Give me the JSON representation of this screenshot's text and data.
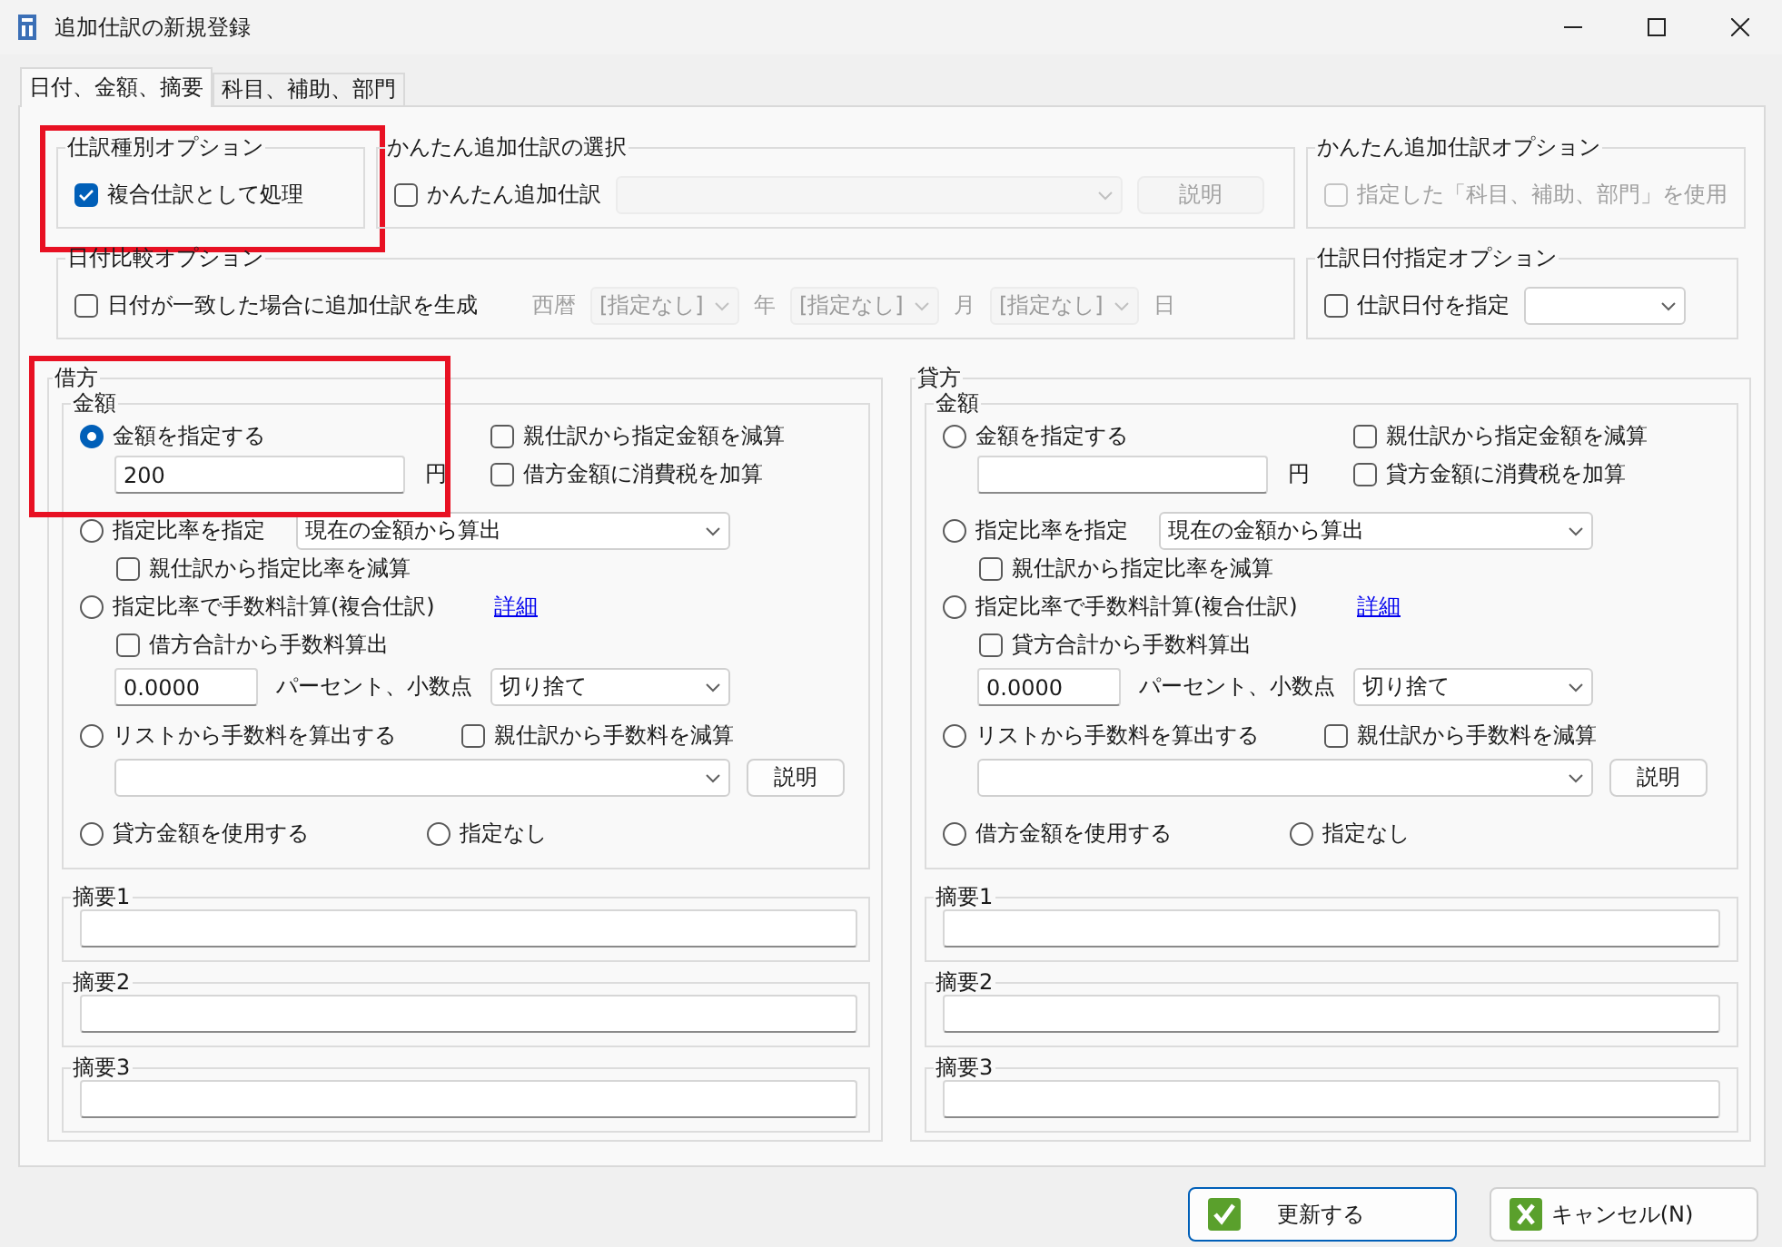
{
  "window": {
    "title": "追加仕訳の新規登録"
  },
  "tabs": [
    {
      "label": "日付、金額、摘要",
      "selected": true
    },
    {
      "label": "科目、補助、部門",
      "selected": false
    }
  ],
  "entry_type_option": {
    "title": "仕訳種別オプション",
    "highlighted": true,
    "checkbox": {
      "label": "複合仕訳として処理",
      "checked": true
    }
  },
  "easy_entry_select": {
    "title": "かんたん追加仕訳の選択",
    "checkbox": {
      "label": "かんたん追加仕訳",
      "checked": false
    },
    "dropdown_disabled": true,
    "button": {
      "label": "説明",
      "disabled": true
    }
  },
  "easy_entry_option": {
    "title": "かんたん追加仕訳オプション",
    "checkbox": {
      "label": "指定した「科目、補助、部門」を使用",
      "checked": false,
      "disabled": true
    }
  },
  "date_compare_option": {
    "title": "日付比較オプション",
    "checkbox": {
      "label": "日付が一致した場合に追加仕訳を生成",
      "checked": false
    },
    "prefix": "西暦",
    "disabled": true,
    "dropdowns": [
      {
        "value": "[指定なし]",
        "unit": "年"
      },
      {
        "value": "[指定なし]",
        "unit": "月"
      },
      {
        "value": "[指定なし]",
        "unit": "日"
      }
    ]
  },
  "entry_date_option": {
    "title": "仕訳日付指定オプション",
    "checkbox": {
      "label": "仕訳日付を指定",
      "checked": false
    }
  },
  "sides": [
    {
      "title": "借方",
      "highlighted": true,
      "amount": {
        "title": "金額",
        "fixed": {
          "label": "金額を指定する",
          "selected": true,
          "value": "200",
          "unit": "円",
          "subtract": {
            "label": "親仕訳から指定金額を減算",
            "checked": false
          },
          "tax": {
            "label": "借方金額に消費税を加算",
            "checked": false
          }
        },
        "ratio": {
          "label": "指定比率を指定",
          "selected": false,
          "dropdown": "現在の金額から算出",
          "subtract": {
            "label": "親仕訳から指定比率を減算",
            "checked": false
          }
        },
        "fee_ratio": {
          "label": "指定比率で手数料計算(複合仕訳)",
          "selected": false,
          "link": "詳細",
          "total": {
            "label": "借方合計から手数料算出",
            "checked": false
          },
          "value": "0.0000",
          "value_label": "パーセント、小数点",
          "rounding": "切り捨て"
        },
        "fee_list": {
          "label": "リストから手数料を算出する",
          "selected": false,
          "subtract": {
            "label": "親仕訳から手数料を減算",
            "checked": false
          },
          "button": "説明"
        },
        "other": {
          "label": "貸方金額を使用する",
          "selected": false
        },
        "none": {
          "label": "指定なし",
          "selected": false
        }
      },
      "summaries": [
        {
          "title": "摘要1"
        },
        {
          "title": "摘要2"
        },
        {
          "title": "摘要3"
        }
      ]
    },
    {
      "title": "貸方",
      "highlighted": false,
      "amount": {
        "title": "金額",
        "fixed": {
          "label": "金額を指定する",
          "selected": false,
          "unit": "円",
          "subtract": {
            "label": "親仕訳から指定金額を減算",
            "checked": false
          },
          "tax": {
            "label": "貸方金額に消費税を加算",
            "checked": false
          }
        },
        "ratio": {
          "label": "指定比率を指定",
          "selected": false,
          "dropdown": "現在の金額から算出",
          "subtract": {
            "label": "親仕訳から指定比率を減算",
            "checked": false
          }
        },
        "fee_ratio": {
          "label": "指定比率で手数料計算(複合仕訳)",
          "selected": false,
          "link": "詳細",
          "total": {
            "label": "貸方合計から手数料算出",
            "checked": false
          },
          "value": "0.0000",
          "value_label": "パーセント、小数点",
          "rounding": "切り捨て"
        },
        "fee_list": {
          "label": "リストから手数料を算出する",
          "selected": false,
          "subtract": {
            "label": "親仕訳から手数料を減算",
            "checked": false
          },
          "button": "説明"
        },
        "other": {
          "label": "借方金額を使用する",
          "selected": false
        },
        "none": {
          "label": "指定なし",
          "selected": false
        }
      },
      "summaries": [
        {
          "title": "摘要1"
        },
        {
          "title": "摘要2"
        },
        {
          "title": "摘要3"
        }
      ]
    }
  ],
  "buttons": [
    {
      "label": "更新する",
      "kind": "ok",
      "default": true
    },
    {
      "label": "キャンセル(N)",
      "kind": "cancel",
      "default": false
    }
  ]
}
